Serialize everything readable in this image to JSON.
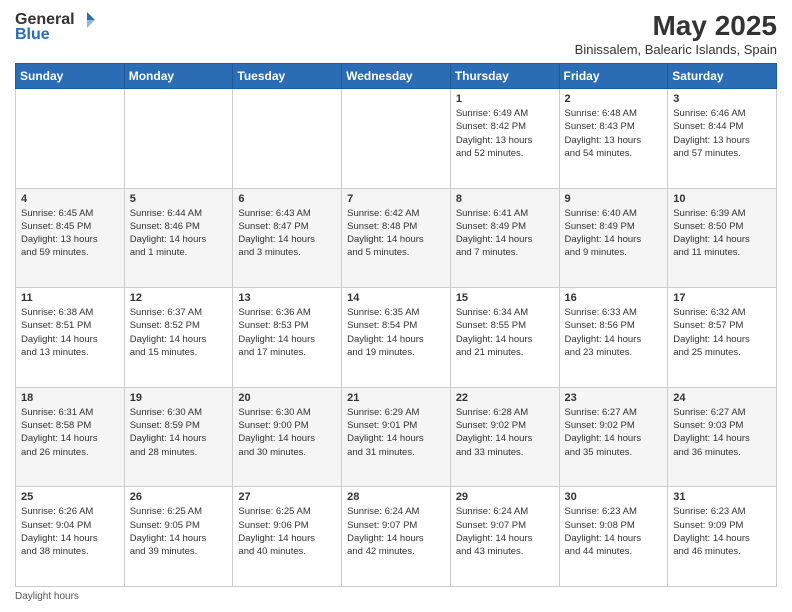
{
  "header": {
    "logo_line1": "General",
    "logo_line2": "Blue",
    "month_title": "May 2025",
    "subtitle": "Binissalem, Balearic Islands, Spain"
  },
  "days_of_week": [
    "Sunday",
    "Monday",
    "Tuesday",
    "Wednesday",
    "Thursday",
    "Friday",
    "Saturday"
  ],
  "weeks": [
    [
      {
        "day": "",
        "info": ""
      },
      {
        "day": "",
        "info": ""
      },
      {
        "day": "",
        "info": ""
      },
      {
        "day": "",
        "info": ""
      },
      {
        "day": "1",
        "info": "Sunrise: 6:49 AM\nSunset: 8:42 PM\nDaylight: 13 hours\nand 52 minutes."
      },
      {
        "day": "2",
        "info": "Sunrise: 6:48 AM\nSunset: 8:43 PM\nDaylight: 13 hours\nand 54 minutes."
      },
      {
        "day": "3",
        "info": "Sunrise: 6:46 AM\nSunset: 8:44 PM\nDaylight: 13 hours\nand 57 minutes."
      }
    ],
    [
      {
        "day": "4",
        "info": "Sunrise: 6:45 AM\nSunset: 8:45 PM\nDaylight: 13 hours\nand 59 minutes."
      },
      {
        "day": "5",
        "info": "Sunrise: 6:44 AM\nSunset: 8:46 PM\nDaylight: 14 hours\nand 1 minute."
      },
      {
        "day": "6",
        "info": "Sunrise: 6:43 AM\nSunset: 8:47 PM\nDaylight: 14 hours\nand 3 minutes."
      },
      {
        "day": "7",
        "info": "Sunrise: 6:42 AM\nSunset: 8:48 PM\nDaylight: 14 hours\nand 5 minutes."
      },
      {
        "day": "8",
        "info": "Sunrise: 6:41 AM\nSunset: 8:49 PM\nDaylight: 14 hours\nand 7 minutes."
      },
      {
        "day": "9",
        "info": "Sunrise: 6:40 AM\nSunset: 8:49 PM\nDaylight: 14 hours\nand 9 minutes."
      },
      {
        "day": "10",
        "info": "Sunrise: 6:39 AM\nSunset: 8:50 PM\nDaylight: 14 hours\nand 11 minutes."
      }
    ],
    [
      {
        "day": "11",
        "info": "Sunrise: 6:38 AM\nSunset: 8:51 PM\nDaylight: 14 hours\nand 13 minutes."
      },
      {
        "day": "12",
        "info": "Sunrise: 6:37 AM\nSunset: 8:52 PM\nDaylight: 14 hours\nand 15 minutes."
      },
      {
        "day": "13",
        "info": "Sunrise: 6:36 AM\nSunset: 8:53 PM\nDaylight: 14 hours\nand 17 minutes."
      },
      {
        "day": "14",
        "info": "Sunrise: 6:35 AM\nSunset: 8:54 PM\nDaylight: 14 hours\nand 19 minutes."
      },
      {
        "day": "15",
        "info": "Sunrise: 6:34 AM\nSunset: 8:55 PM\nDaylight: 14 hours\nand 21 minutes."
      },
      {
        "day": "16",
        "info": "Sunrise: 6:33 AM\nSunset: 8:56 PM\nDaylight: 14 hours\nand 23 minutes."
      },
      {
        "day": "17",
        "info": "Sunrise: 6:32 AM\nSunset: 8:57 PM\nDaylight: 14 hours\nand 25 minutes."
      }
    ],
    [
      {
        "day": "18",
        "info": "Sunrise: 6:31 AM\nSunset: 8:58 PM\nDaylight: 14 hours\nand 26 minutes."
      },
      {
        "day": "19",
        "info": "Sunrise: 6:30 AM\nSunset: 8:59 PM\nDaylight: 14 hours\nand 28 minutes."
      },
      {
        "day": "20",
        "info": "Sunrise: 6:30 AM\nSunset: 9:00 PM\nDaylight: 14 hours\nand 30 minutes."
      },
      {
        "day": "21",
        "info": "Sunrise: 6:29 AM\nSunset: 9:01 PM\nDaylight: 14 hours\nand 31 minutes."
      },
      {
        "day": "22",
        "info": "Sunrise: 6:28 AM\nSunset: 9:02 PM\nDaylight: 14 hours\nand 33 minutes."
      },
      {
        "day": "23",
        "info": "Sunrise: 6:27 AM\nSunset: 9:02 PM\nDaylight: 14 hours\nand 35 minutes."
      },
      {
        "day": "24",
        "info": "Sunrise: 6:27 AM\nSunset: 9:03 PM\nDaylight: 14 hours\nand 36 minutes."
      }
    ],
    [
      {
        "day": "25",
        "info": "Sunrise: 6:26 AM\nSunset: 9:04 PM\nDaylight: 14 hours\nand 38 minutes."
      },
      {
        "day": "26",
        "info": "Sunrise: 6:25 AM\nSunset: 9:05 PM\nDaylight: 14 hours\nand 39 minutes."
      },
      {
        "day": "27",
        "info": "Sunrise: 6:25 AM\nSunset: 9:06 PM\nDaylight: 14 hours\nand 40 minutes."
      },
      {
        "day": "28",
        "info": "Sunrise: 6:24 AM\nSunset: 9:07 PM\nDaylight: 14 hours\nand 42 minutes."
      },
      {
        "day": "29",
        "info": "Sunrise: 6:24 AM\nSunset: 9:07 PM\nDaylight: 14 hours\nand 43 minutes."
      },
      {
        "day": "30",
        "info": "Sunrise: 6:23 AM\nSunset: 9:08 PM\nDaylight: 14 hours\nand 44 minutes."
      },
      {
        "day": "31",
        "info": "Sunrise: 6:23 AM\nSunset: 9:09 PM\nDaylight: 14 hours\nand 46 minutes."
      }
    ]
  ],
  "footer": {
    "note": "Daylight hours"
  }
}
